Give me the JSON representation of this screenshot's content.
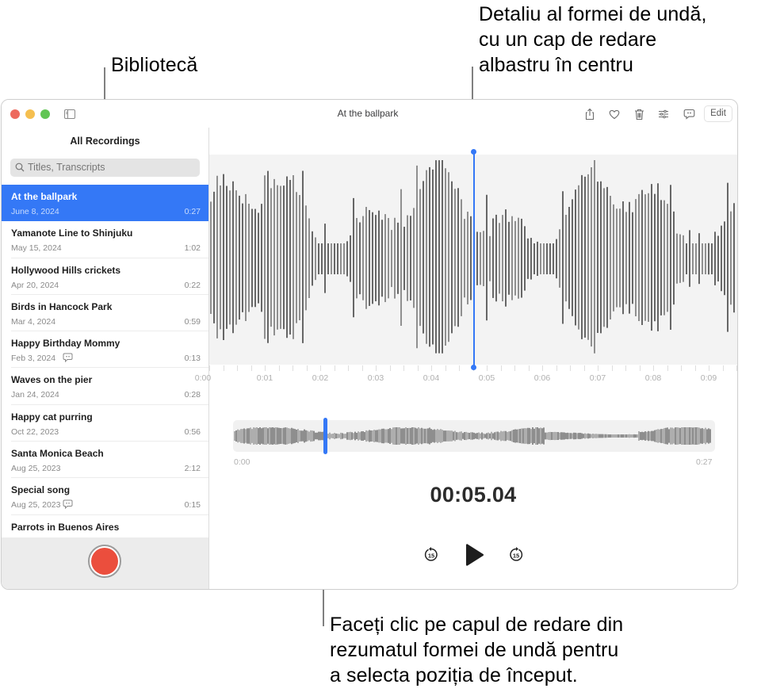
{
  "annotations": {
    "library": "Bibliotecă",
    "waveform_detail": [
      "Detaliu al formei de undă,",
      "cu un cap de redare",
      "albastru în centru"
    ],
    "playhead_tip": [
      "Faceți clic pe capul de redare din",
      "rezumatul formei de undă pentru",
      "a selecta poziția de început."
    ]
  },
  "window": {
    "title": "At the ballpark",
    "toolbar": {
      "share_icon": "share-icon",
      "favorite_icon": "heart-icon",
      "delete_icon": "trash-icon",
      "settings_icon": "sliders-icon",
      "transcript_icon": "transcript-bubble-icon",
      "edit_label": "Edit"
    }
  },
  "sidebar": {
    "heading": "All Recordings",
    "search_placeholder": "Titles, Transcripts",
    "recordings": [
      {
        "name": "At the ballpark",
        "date": "June 8, 2024",
        "duration": "0:27",
        "selected": true,
        "transcript": false
      },
      {
        "name": "Yamanote Line to Shinjuku",
        "date": "May 15, 2024",
        "duration": "1:02",
        "selected": false,
        "transcript": false
      },
      {
        "name": "Hollywood Hills crickets",
        "date": "Apr 20, 2024",
        "duration": "0:22",
        "selected": false,
        "transcript": false
      },
      {
        "name": "Birds in Hancock Park",
        "date": "Mar 4, 2024",
        "duration": "0:59",
        "selected": false,
        "transcript": false
      },
      {
        "name": "Happy Birthday Mommy",
        "date": "Feb 3, 2024",
        "duration": "0:13",
        "selected": false,
        "transcript": true
      },
      {
        "name": "Waves on the pier",
        "date": "Jan 24, 2024",
        "duration": "0:28",
        "selected": false,
        "transcript": false
      },
      {
        "name": "Happy cat purring",
        "date": "Oct 22, 2023",
        "duration": "0:56",
        "selected": false,
        "transcript": false
      },
      {
        "name": "Santa Monica Beach",
        "date": "Aug 25, 2023",
        "duration": "2:12",
        "selected": false,
        "transcript": false
      },
      {
        "name": "Special song",
        "date": "Aug 25, 2023",
        "duration": "0:15",
        "selected": false,
        "transcript": true
      },
      {
        "name": "Parrots in Buenos Aires",
        "date": "",
        "duration": "",
        "selected": false,
        "transcript": false
      }
    ],
    "record_button": "record"
  },
  "player": {
    "timeline_labels": [
      "0:00",
      "0:01",
      "0:02",
      "0:03",
      "0:04",
      "0:05",
      "0:06",
      "0:07",
      "0:08",
      "0:09"
    ],
    "overview_start": "0:00",
    "overview_end": "0:27",
    "current_time": "00:05.04",
    "playhead_position_fraction": 0.187,
    "skip_back_seconds": "15",
    "skip_forward_seconds": "15",
    "accent_color": "#3478f6",
    "record_color": "#eb4e3d"
  }
}
